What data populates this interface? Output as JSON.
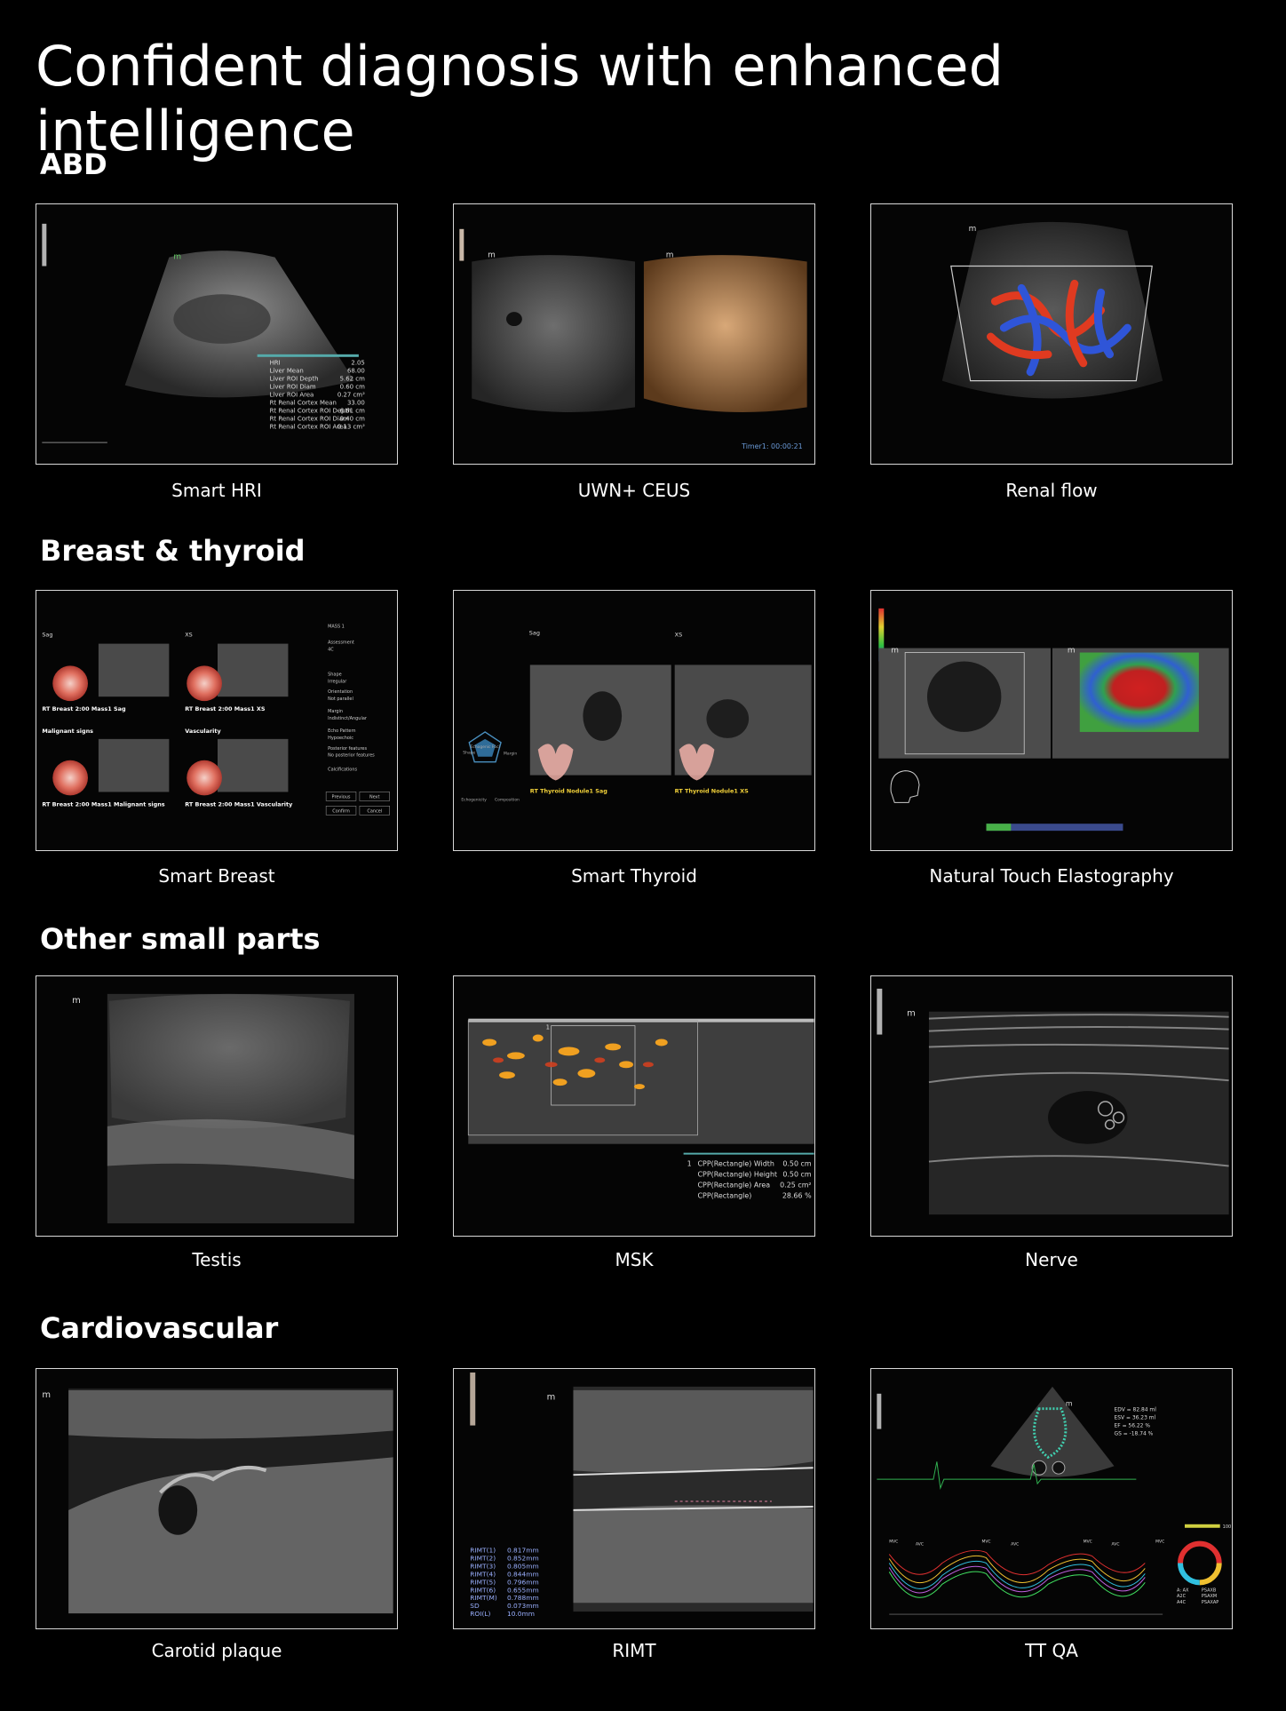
{
  "page": {
    "title": "Confident diagnosis with enhanced intelligence"
  },
  "sections": [
    {
      "title": "ABD",
      "items": [
        {
          "caption": "Smart HRI"
        },
        {
          "caption": "UWN+ CEUS"
        },
        {
          "caption": "Renal flow"
        }
      ]
    },
    {
      "title": "Breast & thyroid",
      "items": [
        {
          "caption": "Smart Breast"
        },
        {
          "caption": "Smart Thyroid"
        },
        {
          "caption": "Natural Touch Elastography"
        }
      ]
    },
    {
      "title": "Other small parts",
      "items": [
        {
          "caption": "Testis"
        },
        {
          "caption": "MSK"
        },
        {
          "caption": "Nerve"
        }
      ]
    },
    {
      "title": "Cardiovascular",
      "items": [
        {
          "caption": "Carotid plaque"
        },
        {
          "caption": "RIMT"
        },
        {
          "caption": "TT QA"
        }
      ]
    }
  ],
  "hri_readout": {
    "rows": [
      {
        "label": "HRI",
        "value": "2.05"
      },
      {
        "label": "Liver Mean",
        "value": "68.00"
      },
      {
        "label": "Liver ROI Depth",
        "value": "5.62 cm"
      },
      {
        "label": "Liver ROI Diam",
        "value": "0.60 cm"
      },
      {
        "label": "Liver ROI Area",
        "value": "0.27 cm²"
      },
      {
        "label": "Rt Renal Cortex Mean",
        "value": "33.00"
      },
      {
        "label": "Rt Renal Cortex ROI Depth",
        "value": "6.61 cm"
      },
      {
        "label": "Rt Renal Cortex ROI Diam",
        "value": "0.40 cm"
      },
      {
        "label": "Rt Renal Cortex ROI Area",
        "value": "0.13 cm²"
      }
    ]
  },
  "ceus_timer": "Timer1: 00:00:21",
  "breast_labels": {
    "sag": "Sag",
    "xs": "XS",
    "q1": "RT Breast 2:00 Mass1 Sag",
    "q2": "RT Breast 2:00 Mass1 XS",
    "malignant": "Malignant signs",
    "vascularity": "Vascularity",
    "q3": "RT Breast 2:00 Mass1 Malignant signs",
    "q4": "RT Breast 2:00 Mass1 Vascularity",
    "side": [
      "MASS 1",
      "Assessment",
      "4C",
      "Shape",
      "Irregular",
      "Orientation",
      "Not parallel",
      "Margin",
      "Indistinct/Angular",
      "Echo Pattern",
      "Hypoechoic",
      "Posterior features",
      "No posterior features",
      "Calcifications"
    ],
    "prev": "Previous",
    "next": "Next",
    "confirm": "Confirm",
    "cancel": "Cancel"
  },
  "thyroid_labels": {
    "sag": "Sag",
    "xs": "XS",
    "n1": "RT Thyroid Nodule1 Sag",
    "n2": "RT Thyroid Nodule1 XS",
    "radar_top": "Echogenic Foci",
    "radar_left": "Shape",
    "radar_right": "Margin",
    "radar_bl": "Echogenicity",
    "radar_br": "Composition"
  },
  "msk_readout": {
    "index": "1",
    "rows": [
      {
        "label": "CPP(Rectangle) Width",
        "value": "0.50 cm"
      },
      {
        "label": "CPP(Rectangle) Height",
        "value": "0.50 cm"
      },
      {
        "label": "CPP(Rectangle) Area",
        "value": "0.25 cm²"
      },
      {
        "label": "CPP(Rectangle)",
        "value": "28.66 %"
      }
    ]
  },
  "rimt_readout": {
    "rows": [
      {
        "label": "RIMT(1)",
        "value": "0.817mm"
      },
      {
        "label": "RIMT(2)",
        "value": "0.852mm"
      },
      {
        "label": "RIMT(3)",
        "value": "0.805mm"
      },
      {
        "label": "RIMT(4)",
        "value": "0.844mm"
      },
      {
        "label": "RIMT(5)",
        "value": "0.796mm"
      },
      {
        "label": "RIMT(6)",
        "value": "0.655mm"
      },
      {
        "label": "RIMT(M)",
        "value": "0.788mm"
      },
      {
        "label": "SD",
        "value": "0.073mm"
      },
      {
        "label": "ROI(L)",
        "value": "10.0mm"
      }
    ]
  },
  "ttqa_readout": {
    "rows": [
      "EDV = 82.84 ml",
      "ESV = 36.23 ml",
      "EF = 56.22 %",
      "GS = -18.74 %"
    ],
    "legend": [
      "A: AX",
      "A2C",
      "A4C"
    ],
    "legend2": [
      "PSAXB",
      "PSAXM",
      "PSAXAP"
    ],
    "scale_max": "100",
    "events": [
      "MVC",
      "AVC",
      "MVC",
      "AVC",
      "MVC",
      "AVC",
      "MVC"
    ]
  },
  "logo_mark": "m"
}
